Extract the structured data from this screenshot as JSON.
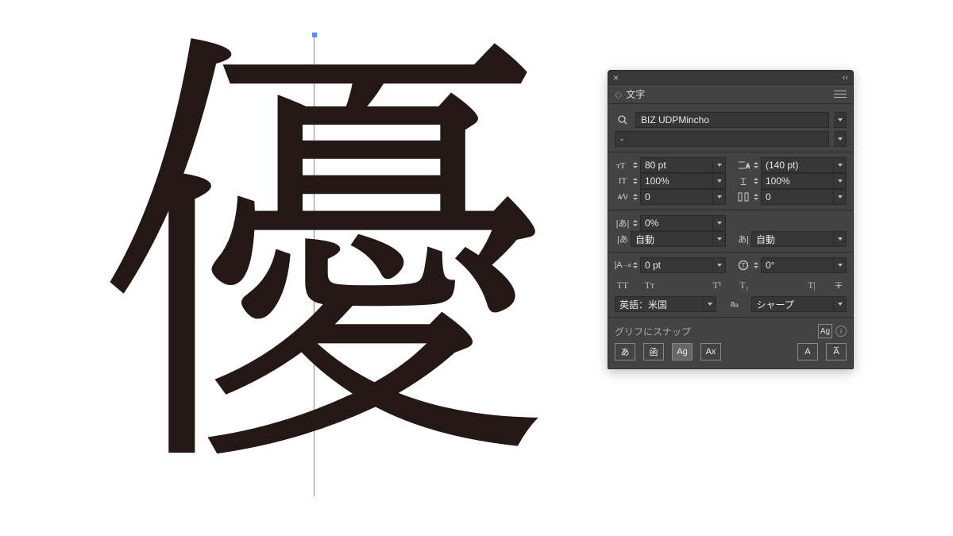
{
  "canvas": {
    "glyph": "優"
  },
  "panel": {
    "title": "文字",
    "font_family": "BIZ UDPMincho",
    "font_style": "-",
    "size": "80 pt",
    "leading": "(140 pt)",
    "vscale": "100%",
    "hscale": "100%",
    "kerning": "0",
    "tracking": "0",
    "tsume": "0%",
    "aki_left": "自動",
    "aki_right": "自動",
    "baseline": "0 pt",
    "rotation": "0°",
    "language": "英語：米国",
    "antialias": "シャープ",
    "snap_label": "グリフにスナップ",
    "type_icons": {
      "allcaps": "TT",
      "smallcaps": "Tᴛ",
      "superscript": "T¹",
      "subscript": "T₁",
      "underline": "T|",
      "strike": "T"
    },
    "aa_label": "aₐ"
  }
}
